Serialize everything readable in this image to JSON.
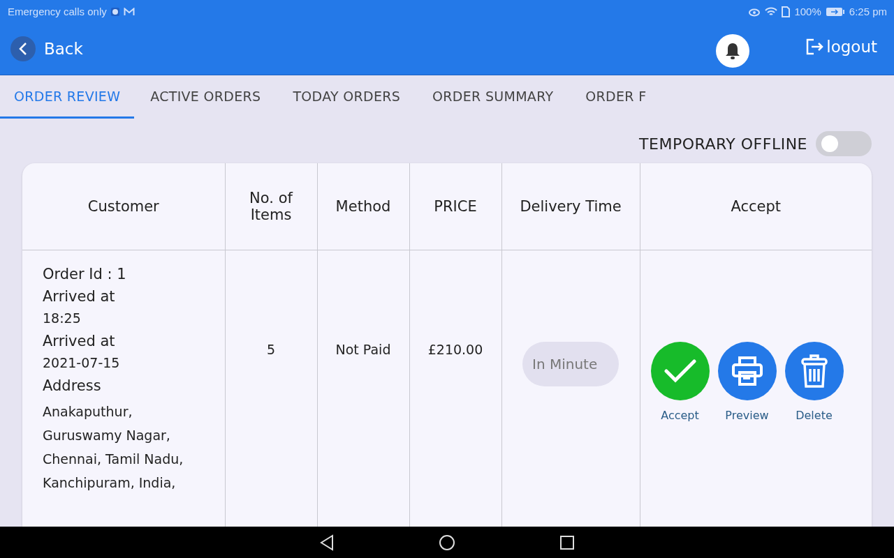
{
  "status_bar": {
    "carrier": "Emergency calls only",
    "battery": "100%",
    "time": "6:25 pm"
  },
  "header": {
    "back": "Back",
    "logout": "logout"
  },
  "tabs": [
    {
      "label": "ORDER REVIEW",
      "selected": true
    },
    {
      "label": "ACTIVE ORDERS",
      "selected": false
    },
    {
      "label": "TODAY ORDERS",
      "selected": false
    },
    {
      "label": "ORDER SUMMARY",
      "selected": false
    },
    {
      "label": "ORDER F",
      "selected": false
    }
  ],
  "offline_toggle": {
    "label": "TEMPORARY OFFLINE",
    "on": false
  },
  "table": {
    "columns": [
      "Customer",
      "No. of Items",
      "Method",
      "PRICE",
      "Delivery Time",
      "Accept"
    ],
    "rows": [
      {
        "order_id": "Order Id : 1",
        "time_label": "Arrived at",
        "time": "18:25",
        "date_label": "Arrived at",
        "date": "2021-07-15",
        "address_label": "Address",
        "address": "Anakaputhur,\nGuruswamy Nagar,\nChennai, Tamil Nadu,\nKanchipuram, India,",
        "items": "5",
        "method": "Not Paid",
        "price": "£210.00",
        "delivery_time": "In Minute",
        "actions": [
          {
            "kind": "accept",
            "label": "Accept"
          },
          {
            "kind": "preview",
            "label": "Preview"
          },
          {
            "kind": "delete",
            "label": "Delete"
          }
        ]
      }
    ]
  }
}
